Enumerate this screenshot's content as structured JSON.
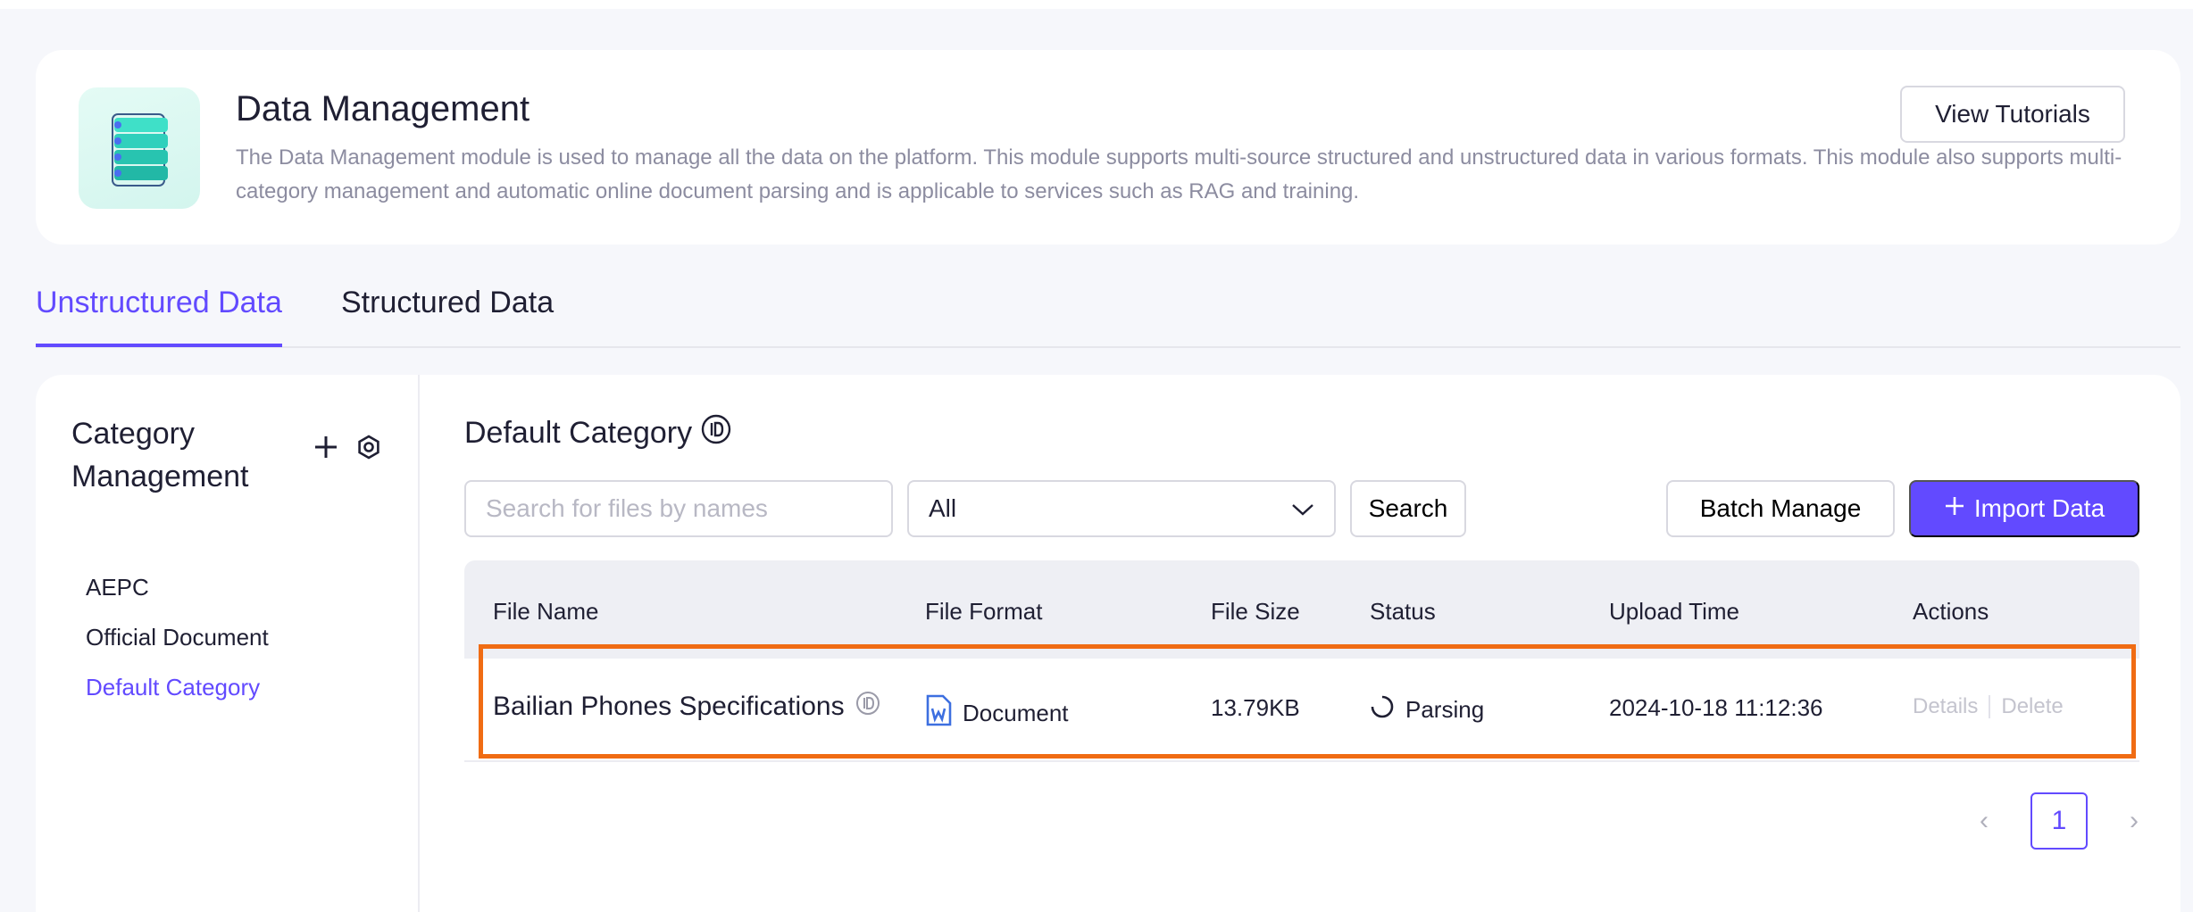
{
  "header": {
    "title": "Data Management",
    "description": "The Data Management module is used to manage all the data on the platform. This module supports multi-source structured and unstructured data in various formats. This module also supports multi-category management and automatic online document parsing and is applicable to services such as RAG and training.",
    "tutorials_label": "View Tutorials",
    "logo_icon": "data-stack-icon"
  },
  "tabs": [
    {
      "label": "Unstructured Data",
      "active": true
    },
    {
      "label": "Structured Data",
      "active": false
    }
  ],
  "sidebar": {
    "title_line1": "Category",
    "title_line2": "Management",
    "add_icon": "plus-icon",
    "settings_icon": "gear-icon",
    "items": [
      {
        "label": "AEPC",
        "active": false
      },
      {
        "label": "Official Document",
        "active": false
      },
      {
        "label": "Default Category",
        "active": true
      }
    ]
  },
  "content": {
    "title": "Default Category",
    "search": {
      "placeholder": "Search for files by names"
    },
    "filter_value": "All",
    "search_label": "Search",
    "batch_label": "Batch Manage",
    "import_label": "Import Data"
  },
  "table": {
    "columns": [
      "File Name",
      "File Format",
      "File Size",
      "Status",
      "Upload Time",
      "Actions"
    ],
    "rows": [
      {
        "name": "Bailian Phones Specifications",
        "format": "Document",
        "size": "13.79KB",
        "status": "Parsing",
        "upload_time": "2024-10-18 11:12:36",
        "action_details": "Details",
        "action_delete": "Delete"
      }
    ]
  },
  "pagination": {
    "current_page": "1"
  },
  "colors": {
    "accent": "#624aff",
    "highlight": "#f06c13"
  }
}
